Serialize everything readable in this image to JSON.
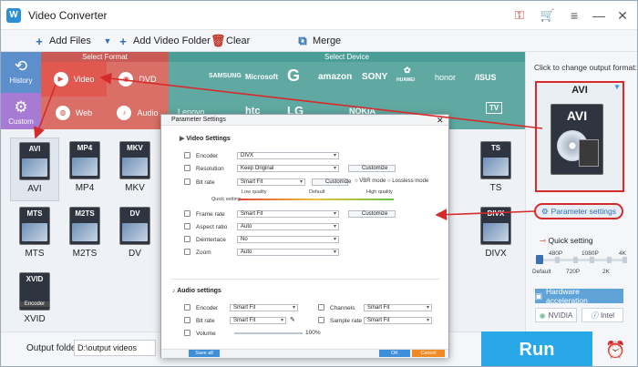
{
  "window": {
    "title": "Video Converter",
    "logo_glyph": "W"
  },
  "toolbar": {
    "add_files": "Add Files",
    "add_folder": "Add Video Folder",
    "clear": "Clear",
    "merge": "Merge"
  },
  "format_panel": {
    "select_format": "Select Format",
    "select_device": "Select Device",
    "side": [
      {
        "label": "History",
        "icon": "history-icon"
      },
      {
        "label": "Custom",
        "icon": "gear-icon"
      }
    ],
    "categories": {
      "video": "Video",
      "dvd": "DVD",
      "web": "Web",
      "audio": "Audio"
    },
    "brands": [
      "SAMSUNG",
      "Microsoft",
      "G",
      "amazon",
      "SONY",
      "HUAWEI",
      "honor",
      "/ISUS",
      "Lenovo",
      "htc",
      "LG",
      "NOKIA",
      "TV"
    ],
    "tiles": [
      {
        "label": "AVI",
        "icon_text": "AVI"
      },
      {
        "label": "MP4",
        "icon_text": "MP4"
      },
      {
        "label": "MKV",
        "icon_text": "MKV"
      },
      {
        "label": "TS",
        "icon_text": "TS"
      },
      {
        "label": "MTS",
        "icon_text": "MTS"
      },
      {
        "label": "M2TS",
        "icon_text": "M2TS"
      },
      {
        "label": "DV",
        "icon_text": "DV"
      },
      {
        "label": "DIVX",
        "icon_text": "DIVX"
      },
      {
        "label": "XVID",
        "icon_text": "XVID",
        "badge": "Encoder"
      }
    ]
  },
  "bottom": {
    "output_label": "Output folder:",
    "output_path": "D:\\output videos"
  },
  "right": {
    "click_note": "Click to change output format:",
    "format": "AVI",
    "big_icon_text": "AVI",
    "param_btn": "Parameter settings",
    "quick_setting": "Quick setting",
    "slider_top": [
      "480P",
      "1080P",
      "4K"
    ],
    "slider_bottom": [
      "Default",
      "720P",
      "2K"
    ],
    "hw_accel": "Hardware acceleration",
    "nvidia": "NVIDIA",
    "intel": "Intel",
    "run": "Run"
  },
  "dialog": {
    "title": "Parameter Settings",
    "video_settings": "Video Settings",
    "encoder_label": "Encoder",
    "encoder": "DIVX",
    "resolution_label": "Resolution",
    "resolution": "Keep Original",
    "customize": "Customize",
    "bitrate_label": "Bit rate",
    "bitrate": "Smart Fit",
    "vbr": "VBR mode",
    "lossless": "Lossless mode",
    "low_quality": "Low quality",
    "default": "Default",
    "high_quality": "High quality",
    "quick_setting": "Quick setting",
    "framerate_label": "Frame rate",
    "framerate": "Smart Fit",
    "aspect_label": "Aspect ratio",
    "aspect": "Auto",
    "deinterlace_label": "Deinterlace",
    "deinterlace": "No",
    "zoom_label": "Zoom",
    "zoom": "Auto",
    "audio_settings": "Audio settings",
    "a_encoder_label": "Encoder",
    "a_encoder": "Smart Fit",
    "channels_label": "Channels",
    "channels": "Smart Fit",
    "a_bitrate_label": "Bit rate",
    "a_bitrate": "Smart Fit",
    "samplerate_label": "Sample rate",
    "samplerate": "Smart Fit",
    "volume_label": "Volume",
    "volume": "100%",
    "save_all": "Save all",
    "ok": "OK",
    "cancel": "Cancel"
  }
}
